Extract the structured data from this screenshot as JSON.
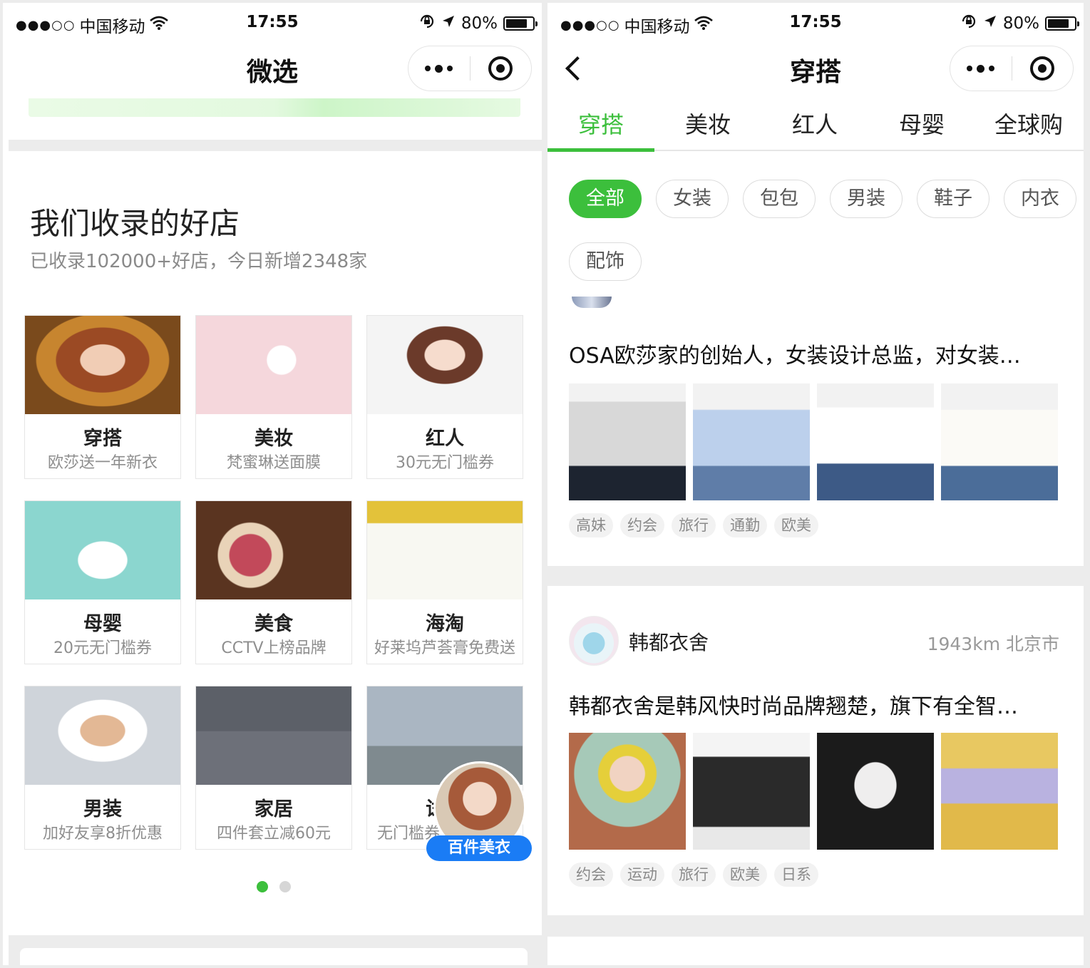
{
  "status_bar": {
    "carrier": "中国移动",
    "signal_dots": "●●●○○",
    "time": "17:55",
    "battery": "80%",
    "battery_level": 0.8
  },
  "left": {
    "nav_title": "微选",
    "section_title": "我们收录的好店",
    "section_subtitle": "已收录102000+好店，今日新增2348家",
    "cards": [
      {
        "title": "穿搭",
        "subtitle": "欧莎送一年新衣"
      },
      {
        "title": "美妆",
        "subtitle": "梵蜜琳送面膜"
      },
      {
        "title": "红人",
        "subtitle": "30元无门槛券"
      },
      {
        "title": "母婴",
        "subtitle": "20元无门槛券"
      },
      {
        "title": "美食",
        "subtitle": "CCTV上榜品牌"
      },
      {
        "title": "海淘",
        "subtitle": "好莱坞芦荟膏免费送"
      },
      {
        "title": "男装",
        "subtitle": "加好友享8折优惠"
      },
      {
        "title": "家居",
        "subtitle": "四件套立减60元"
      },
      {
        "title": "试",
        "subtitle": "无门槛券"
      }
    ],
    "float_badge_label": "百件美衣",
    "pager": {
      "count": 2,
      "active": 0
    }
  },
  "right": {
    "nav_title": "穿搭",
    "tabs": [
      "穿搭",
      "美妆",
      "红人",
      "母婴",
      "全球购"
    ],
    "active_tab": 0,
    "filters": [
      "全部",
      "女装",
      "包包",
      "男装",
      "鞋子",
      "内衣",
      "配饰"
    ],
    "active_filter": 0,
    "post1": {
      "text": "OSA欧莎家的创始人，女装设计总监，对女装…",
      "tags": [
        "高妹",
        "约会",
        "旅行",
        "通勤",
        "欧美"
      ]
    },
    "post2": {
      "shop_name": "韩都衣舍",
      "distance": "1943km 北京市",
      "text": "韩都衣舍是韩风快时尚品牌翘楚，旗下有全智…",
      "tags": [
        "约会",
        "运动",
        "旅行",
        "欧美",
        "日系"
      ]
    }
  },
  "colors": {
    "accent_green": "#3cbf3c",
    "badge_blue": "#1a7cf5",
    "muted_text": "#8a8a8a"
  }
}
